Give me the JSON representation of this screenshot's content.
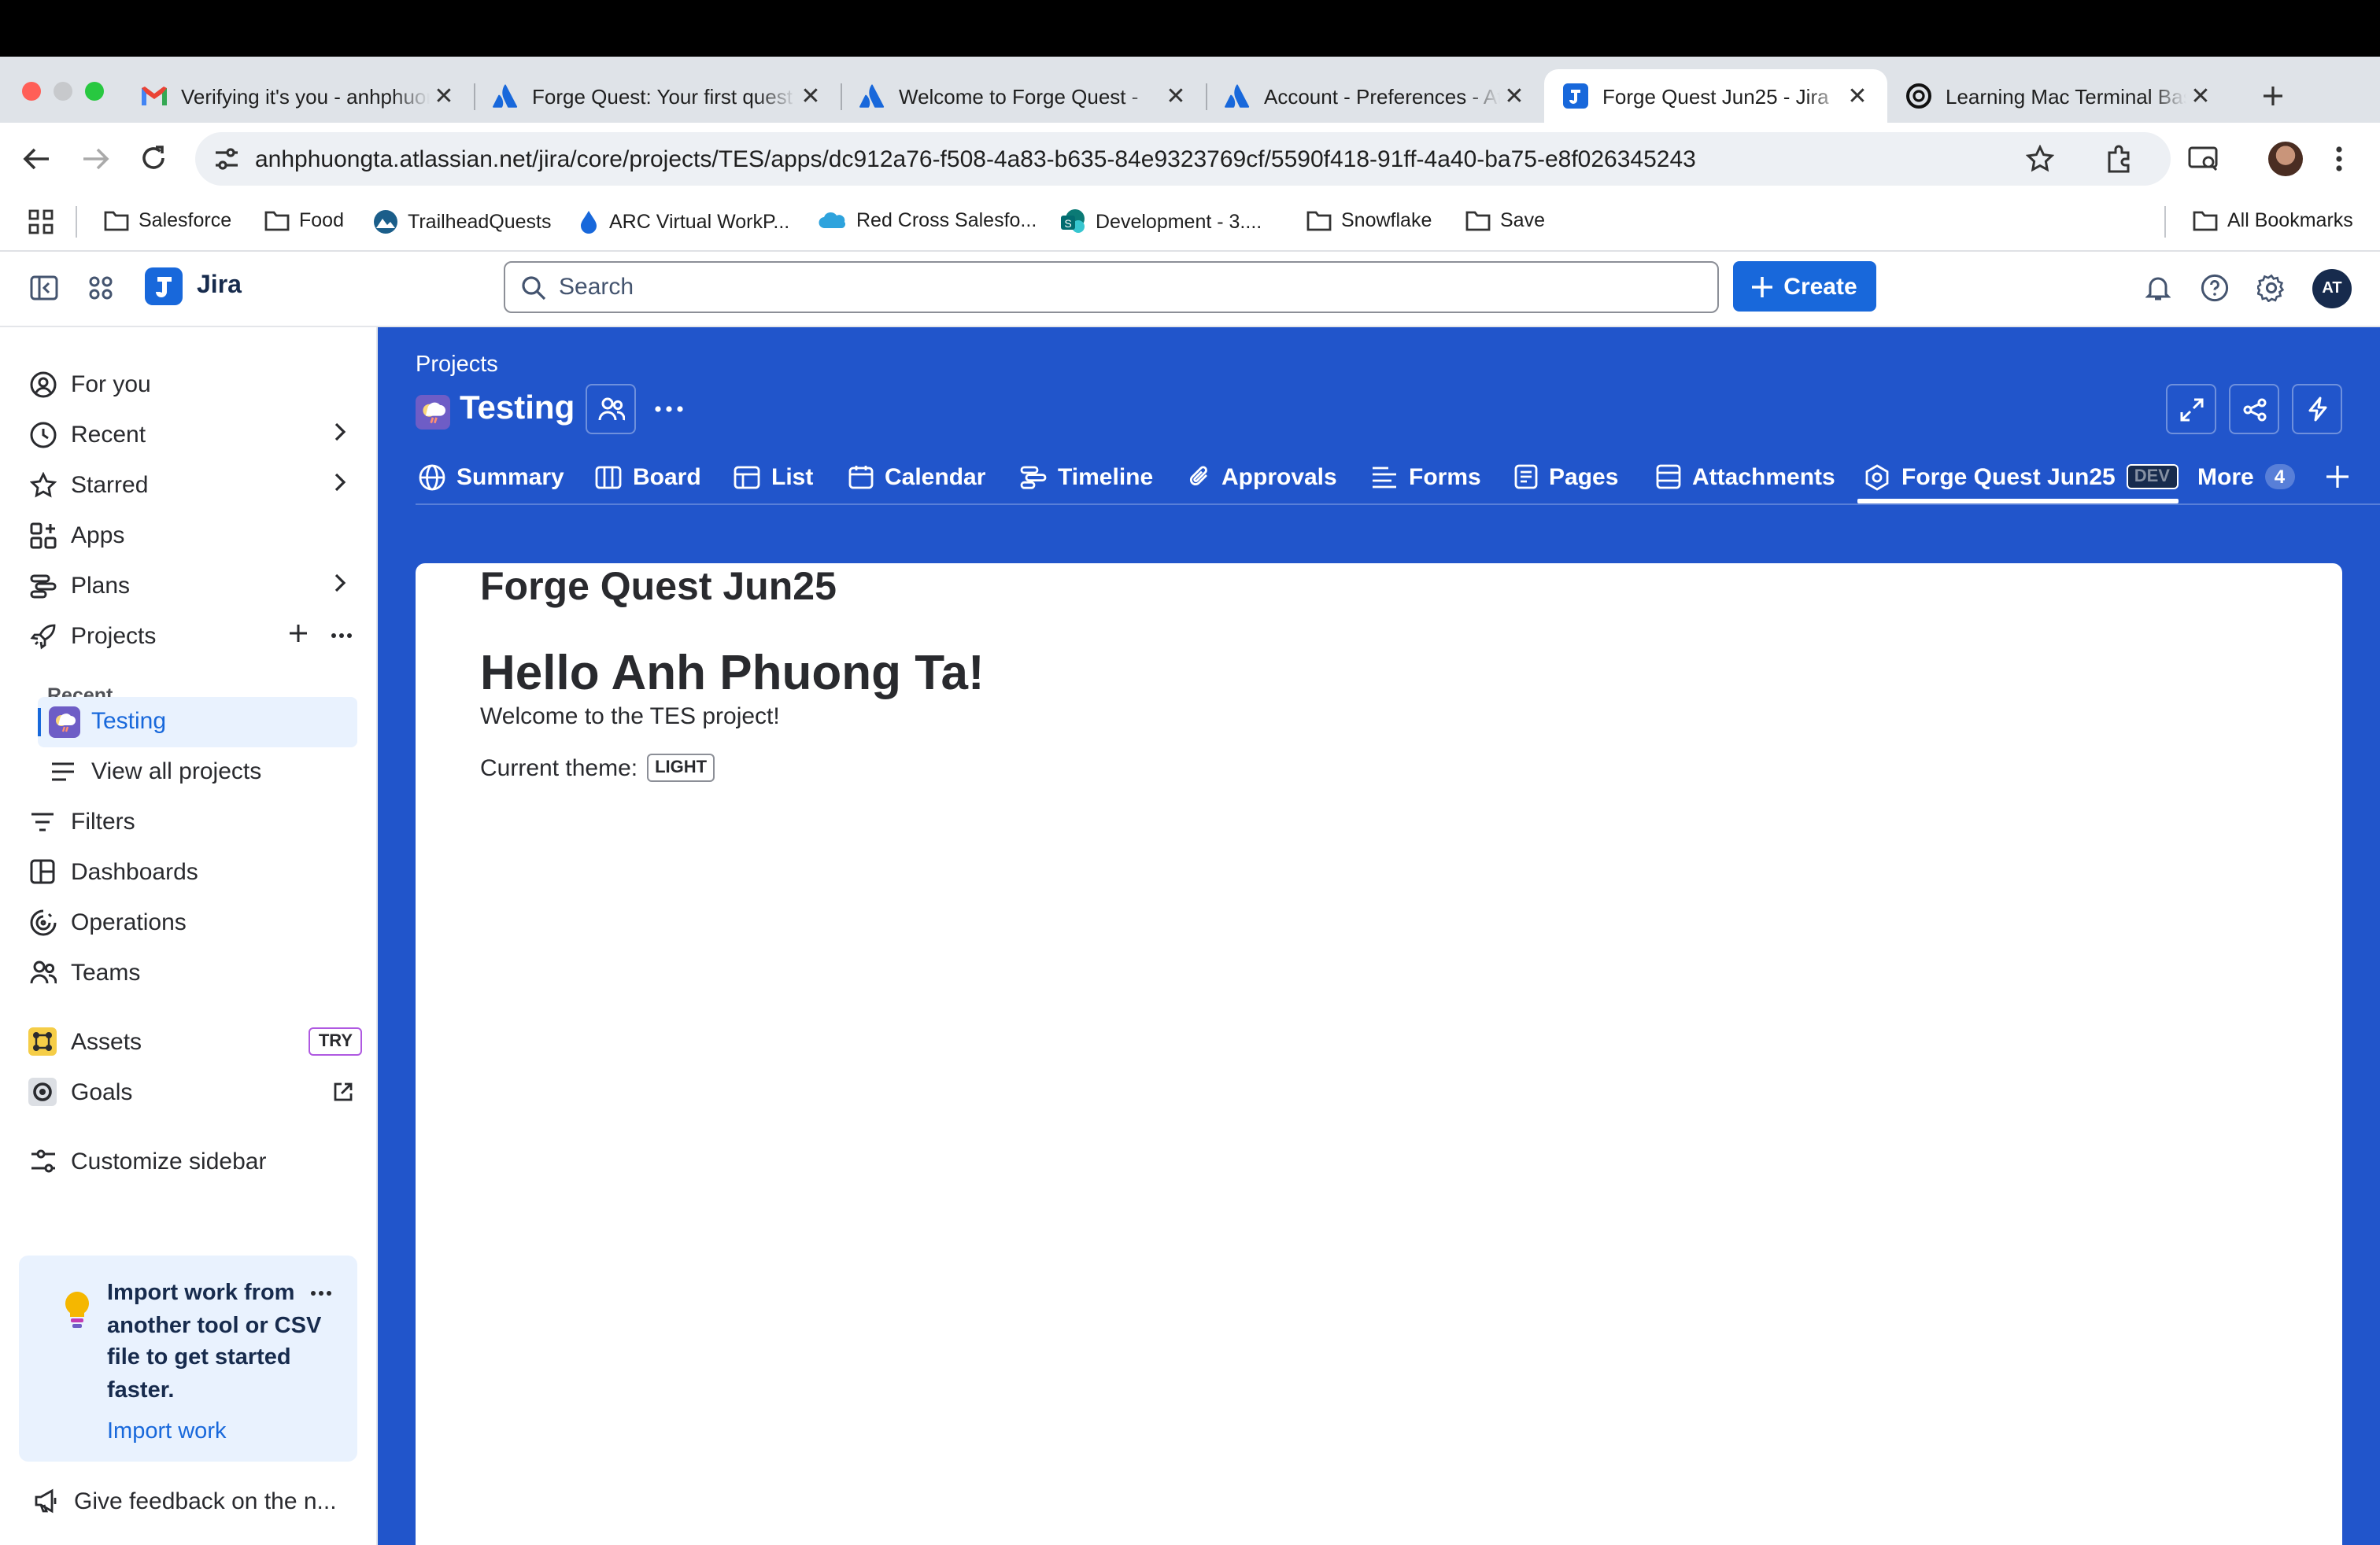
{
  "browser": {
    "tabs": [
      {
        "title": "Verifying it's you - anhphuongta",
        "icon": "gmail-icon"
      },
      {
        "title": "Forge Quest: Your first quest",
        "icon": "atlassian-icon"
      },
      {
        "title": "Welcome to Forge Quest - ",
        "icon": "atlassian-icon"
      },
      {
        "title": "Account - Preferences - Atlassian",
        "icon": "atlassian-icon"
      },
      {
        "title": "Forge Quest Jun25 - Jira",
        "icon": "jira-icon",
        "active": true
      },
      {
        "title": "Learning Mac Terminal Basics",
        "icon": "openai-icon"
      }
    ],
    "url": "anhphuongta.atlassian.net/jira/core/projects/TES/apps/dc912a76-f508-4a83-b635-84e9323769cf/5590f418-91ff-4a40-ba75-e8f026345243",
    "bookmarks": [
      "Salesforce",
      "Food",
      "TrailheadQuests",
      "ARC Virtual WorkP...",
      "Red Cross Salesfo...",
      "Development - 3....",
      "Snowflake",
      "Save"
    ],
    "all_bookmarks": "All Bookmarks"
  },
  "jira": {
    "product": "Jira",
    "search_placeholder": "Search",
    "create_label": "Create",
    "avatar_initials": "AT"
  },
  "sidebar": {
    "items": [
      "For you",
      "Recent",
      "Starred",
      "Apps",
      "Plans",
      "Projects"
    ],
    "recent_heading": "Recent",
    "project": "Testing",
    "view_all": "View all projects",
    "items2": [
      "Filters",
      "Dashboards",
      "Operations",
      "Teams"
    ],
    "assets": "Assets",
    "try_badge": "TRY",
    "goals": "Goals",
    "customize": "Customize sidebar",
    "promo_text": "Import work from another tool or CSV file to get started faster.",
    "promo_link": "Import work",
    "feedback": "Give feedback on the n..."
  },
  "project": {
    "breadcrumb": "Projects",
    "name": "Testing",
    "tabs": [
      "Summary",
      "Board",
      "List",
      "Calendar",
      "Timeline",
      "Approvals",
      "Forms",
      "Pages",
      "Attachments",
      "Forge Quest Jun25"
    ],
    "dev_badge": "DEV",
    "more_label": "More",
    "more_count": "4"
  },
  "app": {
    "title": "Forge Quest Jun25",
    "greeting": "Hello Anh Phuong Ta!",
    "welcome": "Welcome to the TES project!",
    "theme_label": "Current theme:",
    "theme_value": "LIGHT"
  },
  "colors": {
    "brand_blue": "#2155cb",
    "button_blue": "#1868db",
    "selected_bg": "#e9f2fe"
  }
}
